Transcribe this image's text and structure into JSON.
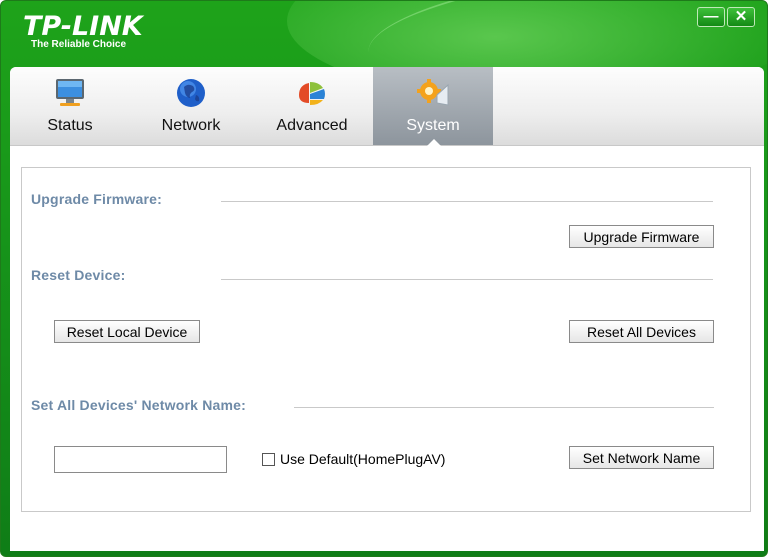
{
  "app": {
    "brand": "TP-LINK",
    "tagline": "The Reliable Choice",
    "window_controls": {
      "minimize": "—",
      "close": "✕"
    }
  },
  "tabs": [
    {
      "label": "Status",
      "icon": "monitor-icon",
      "active": false
    },
    {
      "label": "Network",
      "icon": "globe-icon",
      "active": false
    },
    {
      "label": "Advanced",
      "icon": "advanced-icon",
      "active": false
    },
    {
      "label": "System",
      "icon": "gear-icon",
      "active": true
    }
  ],
  "system": {
    "upgrade_title": "Upgrade Firmware:",
    "upgrade_button": "Upgrade Firmware",
    "reset_title": "Reset Device:",
    "reset_local_button": "Reset Local Device",
    "reset_all_button": "Reset All Devices",
    "network_name_title": "Set All Devices' Network Name:",
    "network_name_value": "",
    "use_default_label": "Use Default(HomePlugAV)",
    "use_default_checked": false,
    "set_name_button": "Set Network Name"
  },
  "colors": {
    "brand_green": "#17951a",
    "section_title": "#6e8aa7",
    "active_tab": "#8d959d"
  }
}
